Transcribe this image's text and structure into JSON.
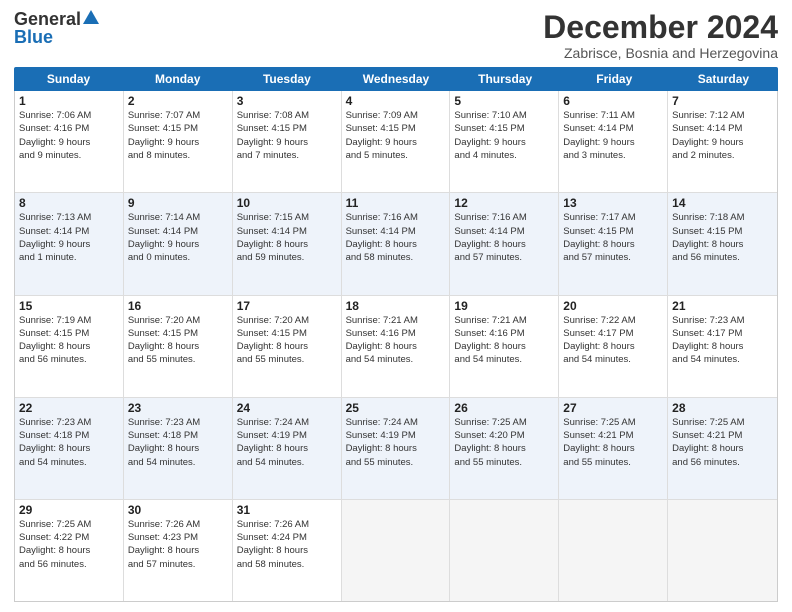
{
  "logo": {
    "general": "General",
    "blue": "Blue"
  },
  "title": "December 2024",
  "location": "Zabrisce, Bosnia and Herzegovina",
  "headers": [
    "Sunday",
    "Monday",
    "Tuesday",
    "Wednesday",
    "Thursday",
    "Friday",
    "Saturday"
  ],
  "weeks": [
    [
      {
        "day": "1",
        "info": "Sunrise: 7:06 AM\nSunset: 4:16 PM\nDaylight: 9 hours\nand 9 minutes."
      },
      {
        "day": "2",
        "info": "Sunrise: 7:07 AM\nSunset: 4:15 PM\nDaylight: 9 hours\nand 8 minutes."
      },
      {
        "day": "3",
        "info": "Sunrise: 7:08 AM\nSunset: 4:15 PM\nDaylight: 9 hours\nand 7 minutes."
      },
      {
        "day": "4",
        "info": "Sunrise: 7:09 AM\nSunset: 4:15 PM\nDaylight: 9 hours\nand 5 minutes."
      },
      {
        "day": "5",
        "info": "Sunrise: 7:10 AM\nSunset: 4:15 PM\nDaylight: 9 hours\nand 4 minutes."
      },
      {
        "day": "6",
        "info": "Sunrise: 7:11 AM\nSunset: 4:14 PM\nDaylight: 9 hours\nand 3 minutes."
      },
      {
        "day": "7",
        "info": "Sunrise: 7:12 AM\nSunset: 4:14 PM\nDaylight: 9 hours\nand 2 minutes."
      }
    ],
    [
      {
        "day": "8",
        "info": "Sunrise: 7:13 AM\nSunset: 4:14 PM\nDaylight: 9 hours\nand 1 minute."
      },
      {
        "day": "9",
        "info": "Sunrise: 7:14 AM\nSunset: 4:14 PM\nDaylight: 9 hours\nand 0 minutes."
      },
      {
        "day": "10",
        "info": "Sunrise: 7:15 AM\nSunset: 4:14 PM\nDaylight: 8 hours\nand 59 minutes."
      },
      {
        "day": "11",
        "info": "Sunrise: 7:16 AM\nSunset: 4:14 PM\nDaylight: 8 hours\nand 58 minutes."
      },
      {
        "day": "12",
        "info": "Sunrise: 7:16 AM\nSunset: 4:14 PM\nDaylight: 8 hours\nand 57 minutes."
      },
      {
        "day": "13",
        "info": "Sunrise: 7:17 AM\nSunset: 4:15 PM\nDaylight: 8 hours\nand 57 minutes."
      },
      {
        "day": "14",
        "info": "Sunrise: 7:18 AM\nSunset: 4:15 PM\nDaylight: 8 hours\nand 56 minutes."
      }
    ],
    [
      {
        "day": "15",
        "info": "Sunrise: 7:19 AM\nSunset: 4:15 PM\nDaylight: 8 hours\nand 56 minutes."
      },
      {
        "day": "16",
        "info": "Sunrise: 7:20 AM\nSunset: 4:15 PM\nDaylight: 8 hours\nand 55 minutes."
      },
      {
        "day": "17",
        "info": "Sunrise: 7:20 AM\nSunset: 4:15 PM\nDaylight: 8 hours\nand 55 minutes."
      },
      {
        "day": "18",
        "info": "Sunrise: 7:21 AM\nSunset: 4:16 PM\nDaylight: 8 hours\nand 54 minutes."
      },
      {
        "day": "19",
        "info": "Sunrise: 7:21 AM\nSunset: 4:16 PM\nDaylight: 8 hours\nand 54 minutes."
      },
      {
        "day": "20",
        "info": "Sunrise: 7:22 AM\nSunset: 4:17 PM\nDaylight: 8 hours\nand 54 minutes."
      },
      {
        "day": "21",
        "info": "Sunrise: 7:23 AM\nSunset: 4:17 PM\nDaylight: 8 hours\nand 54 minutes."
      }
    ],
    [
      {
        "day": "22",
        "info": "Sunrise: 7:23 AM\nSunset: 4:18 PM\nDaylight: 8 hours\nand 54 minutes."
      },
      {
        "day": "23",
        "info": "Sunrise: 7:23 AM\nSunset: 4:18 PM\nDaylight: 8 hours\nand 54 minutes."
      },
      {
        "day": "24",
        "info": "Sunrise: 7:24 AM\nSunset: 4:19 PM\nDaylight: 8 hours\nand 54 minutes."
      },
      {
        "day": "25",
        "info": "Sunrise: 7:24 AM\nSunset: 4:19 PM\nDaylight: 8 hours\nand 55 minutes."
      },
      {
        "day": "26",
        "info": "Sunrise: 7:25 AM\nSunset: 4:20 PM\nDaylight: 8 hours\nand 55 minutes."
      },
      {
        "day": "27",
        "info": "Sunrise: 7:25 AM\nSunset: 4:21 PM\nDaylight: 8 hours\nand 55 minutes."
      },
      {
        "day": "28",
        "info": "Sunrise: 7:25 AM\nSunset: 4:21 PM\nDaylight: 8 hours\nand 56 minutes."
      }
    ],
    [
      {
        "day": "29",
        "info": "Sunrise: 7:25 AM\nSunset: 4:22 PM\nDaylight: 8 hours\nand 56 minutes."
      },
      {
        "day": "30",
        "info": "Sunrise: 7:26 AM\nSunset: 4:23 PM\nDaylight: 8 hours\nand 57 minutes."
      },
      {
        "day": "31",
        "info": "Sunrise: 7:26 AM\nSunset: 4:24 PM\nDaylight: 8 hours\nand 58 minutes."
      },
      {
        "day": "",
        "info": ""
      },
      {
        "day": "",
        "info": ""
      },
      {
        "day": "",
        "info": ""
      },
      {
        "day": "",
        "info": ""
      }
    ]
  ]
}
